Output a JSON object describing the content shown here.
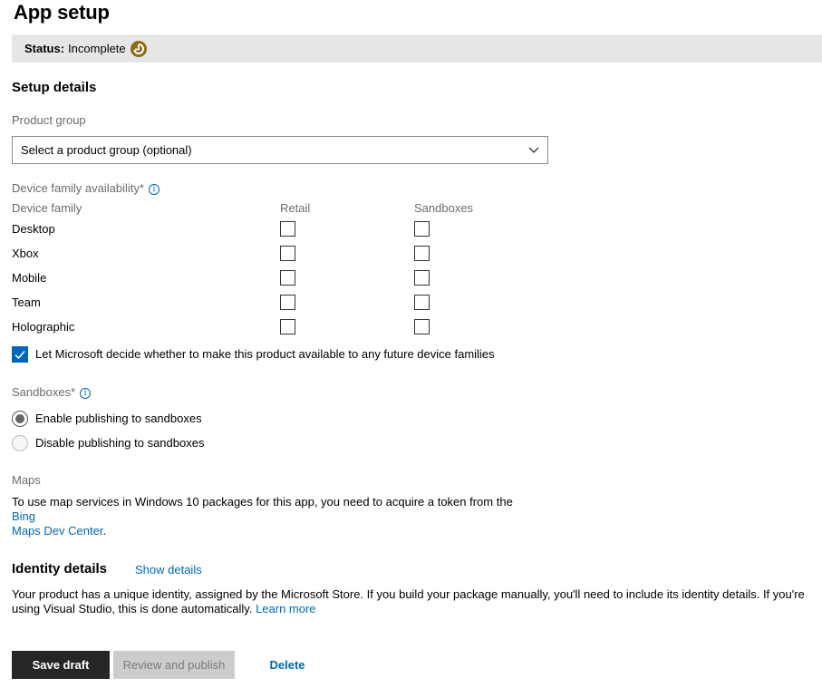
{
  "page": {
    "title": "App setup"
  },
  "status": {
    "label": "Status:",
    "value": "Incomplete",
    "icon": "clock-icon",
    "icon_color": "#8a6d16"
  },
  "setup_details": {
    "title": "Setup details",
    "product_group": {
      "label": "Product group",
      "selected": "Select a product group (optional)"
    },
    "device_family_availability": {
      "label": "Device family availability*",
      "columns": [
        "Device family",
        "Retail",
        "Sandboxes"
      ],
      "rows": [
        {
          "name": "Desktop",
          "retail": false,
          "sandboxes": false
        },
        {
          "name": "Xbox",
          "retail": false,
          "sandboxes": false
        },
        {
          "name": "Mobile",
          "retail": false,
          "sandboxes": false
        },
        {
          "name": "Team",
          "retail": false,
          "sandboxes": false
        },
        {
          "name": "Holographic",
          "retail": false,
          "sandboxes": false
        }
      ],
      "future_families": {
        "label": "Let Microsoft decide whether to make this product available to any future device families",
        "checked": true
      }
    },
    "sandboxes": {
      "label": "Sandboxes*",
      "options": [
        {
          "label": "Enable publishing to sandboxes",
          "selected": true
        },
        {
          "label": "Disable publishing to sandboxes",
          "selected": false
        }
      ]
    },
    "maps": {
      "label": "Maps",
      "text_before": "To use map services in Windows 10 packages for this app, you need to acquire a token from the ",
      "link_part1": "Bing",
      "link_part2": "Maps Dev Center",
      "text_after": "."
    }
  },
  "identity_details": {
    "title": "Identity details",
    "show_details_link": "Show details",
    "text": "Your product has a unique identity, assigned by the Microsoft Store. If you build your package manually, you'll need to include its identity details. If you're using Visual Studio, this is done automatically. ",
    "learn_more_link": "Learn more"
  },
  "actions": {
    "save_draft": "Save draft",
    "review_publish": "Review and publish",
    "delete": "Delete"
  },
  "colors": {
    "accent": "#0067b8",
    "primary_button": "#262626",
    "disabled_button": "#cccccc",
    "status_bar": "#e6e6e6"
  }
}
